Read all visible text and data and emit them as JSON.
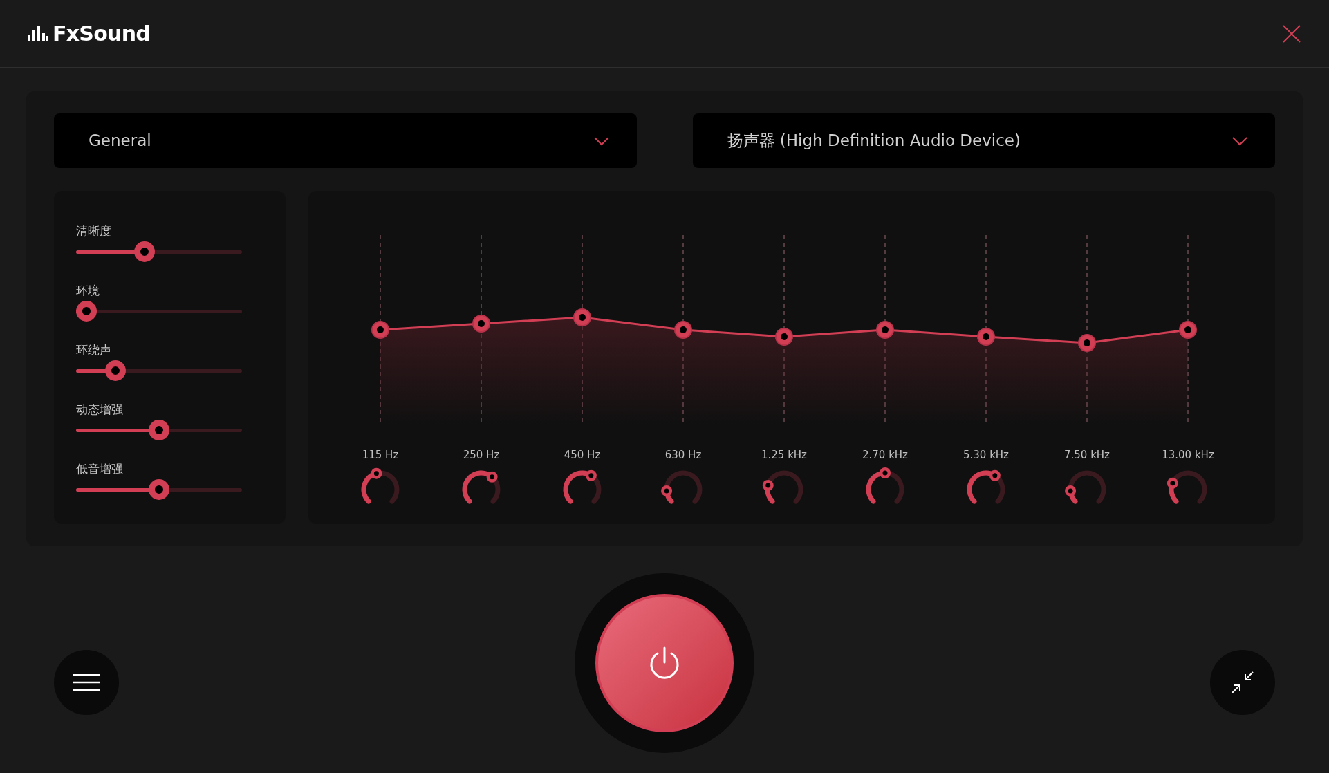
{
  "app": {
    "logo": "FxSound"
  },
  "preset": {
    "value": "General"
  },
  "output": {
    "value": "扬声器 (High Definition Audio Device)"
  },
  "effects": [
    {
      "label": "清晰度",
      "level": 0.4
    },
    {
      "label": "环境",
      "level": 0
    },
    {
      "label": "环绕声",
      "level": 0.2
    },
    {
      "label": "动态增强",
      "level": 0.5
    },
    {
      "label": "低音增强",
      "level": 0.5
    }
  ],
  "equalizer": {
    "bands": [
      {
        "label": "115 Hz"
      },
      {
        "label": "250 Hz"
      },
      {
        "label": "450 Hz"
      },
      {
        "label": "630 Hz"
      },
      {
        "label": "1.25 kHz"
      },
      {
        "label": "2.70 kHz"
      },
      {
        "label": "5.30 kHz"
      },
      {
        "label": "7.50 kHz"
      },
      {
        "label": "13.00 kHz"
      }
    ]
  },
  "power": {
    "on": true
  }
}
